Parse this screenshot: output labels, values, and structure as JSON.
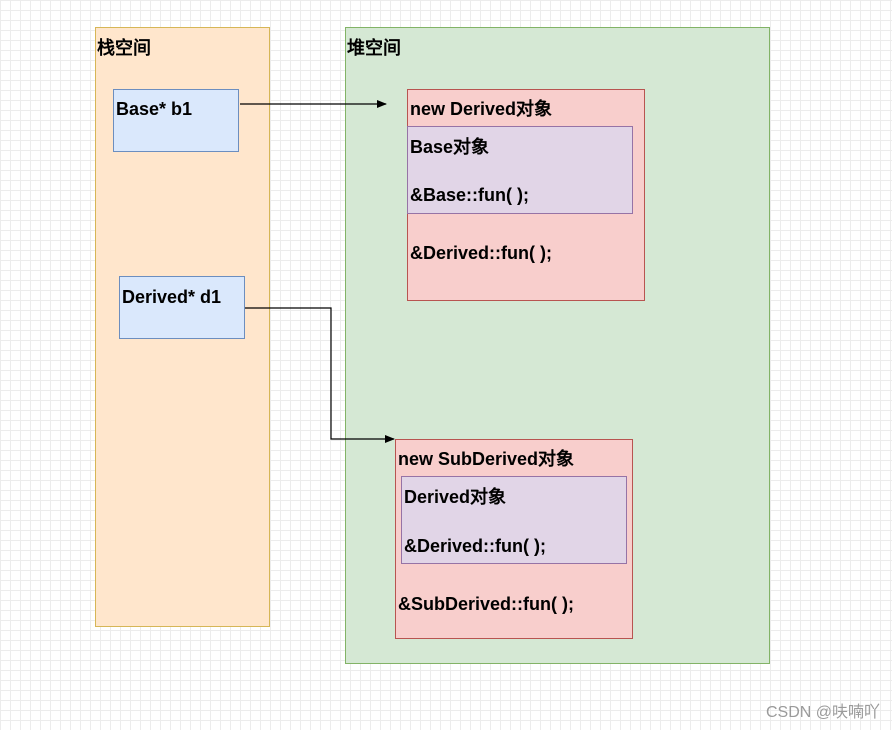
{
  "diagram": {
    "stack": {
      "title": "栈空间"
    },
    "heap": {
      "title": "堆空间"
    },
    "pointers": [
      {
        "label": "Base* b1"
      },
      {
        "label": "Derived* d1"
      }
    ],
    "objects": [
      {
        "title": "new Derived对象",
        "inner_title": "Base对象",
        "inner_method": "&Base::fun( );",
        "outer_method": "&Derived::fun( );"
      },
      {
        "title": "new SubDerived对象",
        "inner_title": "Derived对象",
        "inner_method": "&Derived::fun( );",
        "outer_method": "&SubDerived::fun( );"
      }
    ],
    "colors": {
      "stack_fill": "#ffe6cc",
      "heap_fill": "#d5e8d4",
      "pointer_fill": "#dae8fc",
      "object_fill": "#f8cecc",
      "inner_fill": "#e1d5e7"
    }
  },
  "watermark": "CSDN @呋喃吖"
}
